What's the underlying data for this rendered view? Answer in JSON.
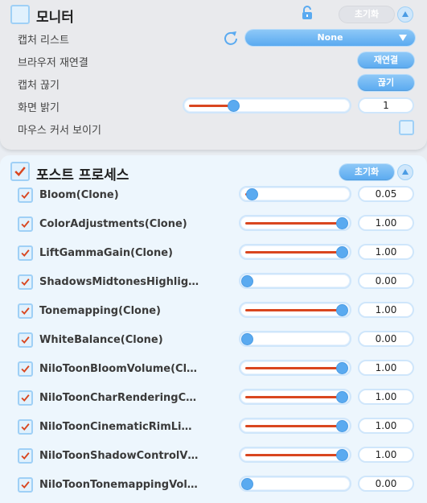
{
  "monitor": {
    "title": "모니터",
    "reset_label": "초기화",
    "rows": {
      "capture_list": {
        "label": "캡처 리스트",
        "dropdown_value": "None"
      },
      "browser_reconnect": {
        "label": "브라우저 재연결",
        "button": "재연결"
      },
      "capture_disconnect": {
        "label": "캡처 끊기",
        "button": "끊기"
      },
      "brightness": {
        "label": "화면 밝기",
        "value": "1",
        "fraction": 0.28
      },
      "show_cursor": {
        "label": "마우스 커서 보이기",
        "checked": false
      }
    }
  },
  "post_process": {
    "title": "포스트 프로세스",
    "reset_label": "초기화",
    "checked": true,
    "items": [
      {
        "label": "Bloom(Clone)",
        "value": "0.05",
        "fraction": 0.05,
        "checked": true
      },
      {
        "label": "ColorAdjustments(Clone)",
        "value": "1.00",
        "fraction": 1.0,
        "checked": true
      },
      {
        "label": "LiftGammaGain(Clone)",
        "value": "1.00",
        "fraction": 1.0,
        "checked": true
      },
      {
        "label": "ShadowsMidtonesHighlig…",
        "value": "0.00",
        "fraction": 0.0,
        "checked": true
      },
      {
        "label": "Tonemapping(Clone)",
        "value": "1.00",
        "fraction": 1.0,
        "checked": true
      },
      {
        "label": "WhiteBalance(Clone)",
        "value": "0.00",
        "fraction": 0.0,
        "checked": true
      },
      {
        "label": "NiloToonBloomVolume(Cl…",
        "value": "1.00",
        "fraction": 1.0,
        "checked": true
      },
      {
        "label": "NiloToonCharRenderingC…",
        "value": "1.00",
        "fraction": 1.0,
        "checked": true
      },
      {
        "label": "NiloToonCinematicRimLi…",
        "value": "1.00",
        "fraction": 1.0,
        "checked": true
      },
      {
        "label": "NiloToonShadowControlV…",
        "value": "1.00",
        "fraction": 1.0,
        "checked": true
      },
      {
        "label": "NiloToonTonemappingVol…",
        "value": "0.00",
        "fraction": 0.0,
        "checked": true
      }
    ]
  },
  "colors": {
    "accent": "#5aaaf0",
    "fill": "#d9461f",
    "check": "#d9461f"
  }
}
